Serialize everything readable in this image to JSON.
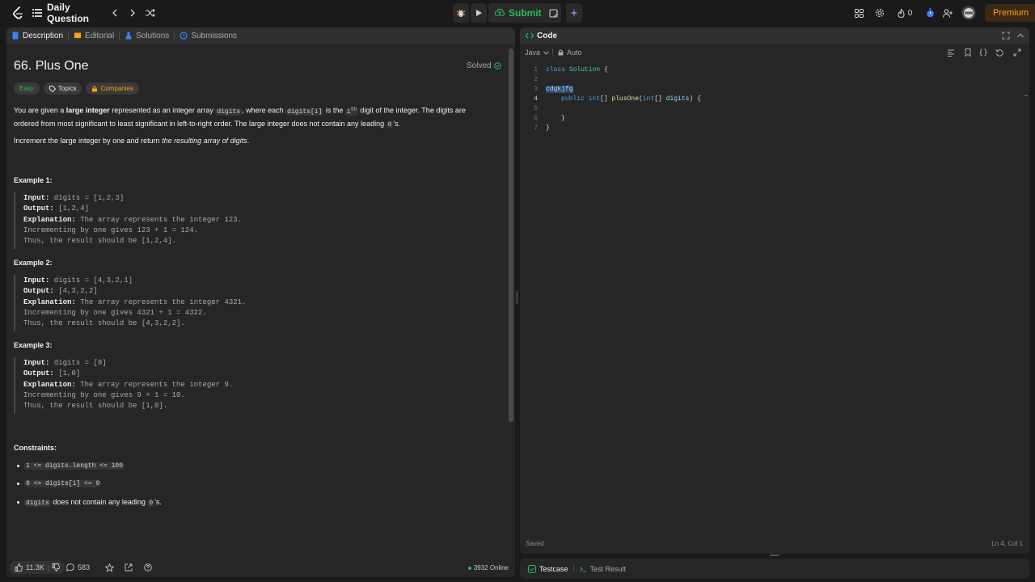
{
  "topnav": {
    "title": "Daily Question",
    "submit_label": "Submit",
    "flame_count": "0",
    "premium_label": "Premium"
  },
  "left_tabs": [
    {
      "label": "Description"
    },
    {
      "label": "Editorial"
    },
    {
      "label": "Solutions"
    },
    {
      "label": "Submissions"
    }
  ],
  "problem": {
    "title": "66. Plus One",
    "status": "Solved",
    "chips": {
      "difficulty": "Easy",
      "topics": "Topics",
      "companies": "Companies"
    },
    "para1": {
      "t1": "You are given a ",
      "b1": "large integer",
      "t2": " represented as an integer array ",
      "c1": "digits",
      "t3": ", where each ",
      "c2": "digits[i]",
      "t4": " is the ",
      "c3": "i",
      "sup": "th",
      "t5": " digit of the integer. The digits are",
      "line2a": "ordered from most significant to least significant in left-to-right order. The large integer does not contain any leading ",
      "c4": "0",
      "line2b": "'s."
    },
    "para2": {
      "t1": "Increment the large integer by one and return ",
      "i1": "the resulting array of digits",
      "t2": "."
    },
    "examples": [
      {
        "heading": "Example 1:",
        "input_label": "Input:",
        "input": " digits = [1,2,3]",
        "output_label": "Output:",
        "output": " [1,2,4]",
        "explanation_label": "Explanation:",
        "explanation": " The array represents the integer 123.",
        "line4": "Incrementing by one gives 123 + 1 = 124.",
        "line5": "Thus, the result should be [1,2,4]."
      },
      {
        "heading": "Example 2:",
        "input_label": "Input:",
        "input": " digits = [4,3,2,1]",
        "output_label": "Output:",
        "output": " [4,3,2,2]",
        "explanation_label": "Explanation:",
        "explanation": " The array represents the integer 4321.",
        "line4": "Incrementing by one gives 4321 + 1 = 4322.",
        "line5": "Thus, the result should be [4,3,2,2]."
      },
      {
        "heading": "Example 3:",
        "input_label": "Input:",
        "input": " digits = [9]",
        "output_label": "Output:",
        "output": " [1,0]",
        "explanation_label": "Explanation:",
        "explanation": " The array represents the integer 9.",
        "line4": "Incrementing by one gives 9 + 1 = 10.",
        "line5": "Thus, the result should be [1,0]."
      }
    ],
    "constraints_heading": "Constraints:",
    "constraints": [
      {
        "code": "1 <= digits.length <= 100",
        "text": ""
      },
      {
        "code": "0 <= digits[i] <= 9",
        "text": ""
      },
      {
        "code": "digits",
        "text": " does not contain any leading ",
        "code2": "0",
        "text2": "'s."
      }
    ]
  },
  "left_footer": {
    "likes": "11.3K",
    "comments": "583",
    "online": "3932 Online"
  },
  "code_panel": {
    "title": "Code",
    "language": "Java",
    "mode": "Auto",
    "lines": [
      {
        "n": "1"
      },
      {
        "n": "2"
      },
      {
        "n": "3"
      },
      {
        "n": "4"
      },
      {
        "n": "5"
      },
      {
        "n": "6"
      },
      {
        "n": "7"
      }
    ],
    "code": {
      "l1_kw": "class",
      "l1_name": " Solution",
      "l1_rest": " {",
      "l3_sel": "cdgkjfg",
      "l4_kw": "public",
      "l4_type": " int",
      "l4_br": "[] ",
      "l4_fn": "plusOne",
      "l4_p1": "(",
      "l4_ptype": "int",
      "l4_p2": "[] ",
      "l4_var": "digits",
      "l4_rest": ") {",
      "l6": "}",
      "l7": "}"
    },
    "saved": "Saved",
    "cursor": "Ln 4, Col 1"
  },
  "test_tabs": [
    {
      "label": "Testcase"
    },
    {
      "label": "Test Result"
    }
  ]
}
